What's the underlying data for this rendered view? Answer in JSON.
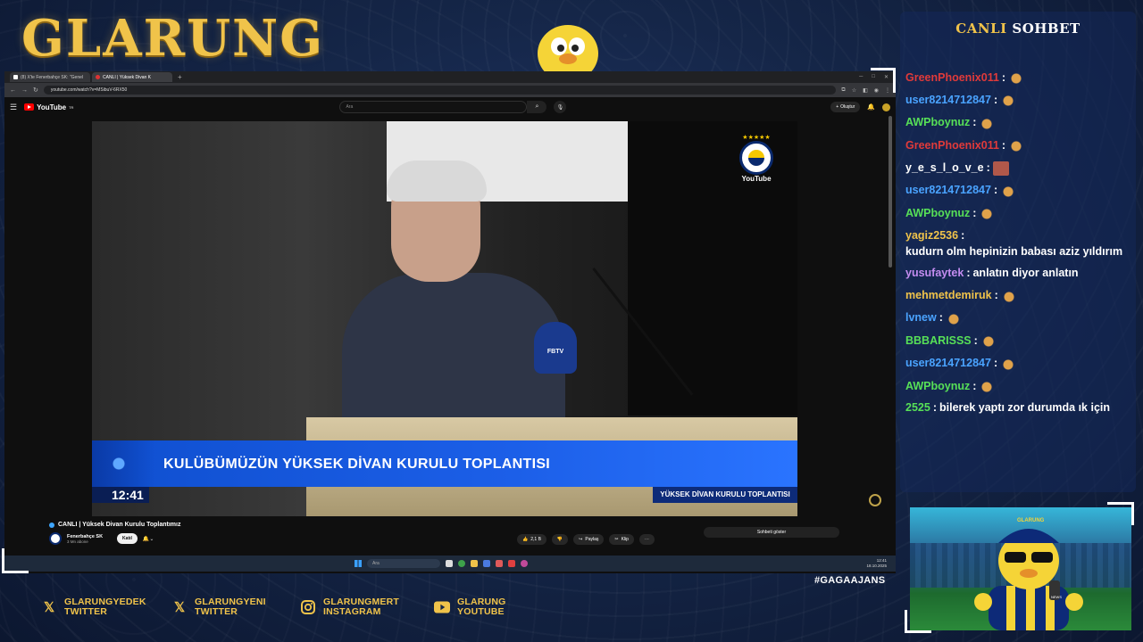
{
  "overlay": {
    "logo": "GLARUNG",
    "hashtag": "#GAGAAJANS",
    "chat_title_a": "CANLI",
    "chat_title_b": "SOHBET"
  },
  "browser": {
    "tabs": [
      {
        "label": "(8) X'te Fenerbahçe SK: \"Genel",
        "icon": "x-icon"
      },
      {
        "label": "CANLI | Yüksek Divan K",
        "icon": "youtube-icon"
      }
    ],
    "url": "youtube.com/watch?v=MSibuV-6RX50"
  },
  "youtube": {
    "logo": "YouTube",
    "logo_sup": "TR",
    "search_placeholder": "Ara",
    "create_label": "Oluştur"
  },
  "video": {
    "crest_label": "YouTube",
    "mic_label": "FBTV",
    "banner_text": "KULÜBÜMÜZÜN YÜKSEK DİVAN KURULU TOPLANTISI",
    "clock": "12:41",
    "sub_tag": "YÜKSEK DİVAN KURULU TOPLANTISI",
    "title": "CANLI | Yüksek Divan Kurulu Toplantımız",
    "channel": "Fenerbahçe SK",
    "subscribers": "3 Mn abone",
    "join_label": "Katıl",
    "likes": "2,1 B",
    "share_label": "Paylaş",
    "clip_label": "Klip",
    "chat_toggle": "Sohbeti göster"
  },
  "taskbar": {
    "search": "Ara",
    "time": "12:41",
    "date": "18.10.2025"
  },
  "chat": [
    {
      "user": "GreenPhoenix011",
      "user_color": "#e03a3a",
      "text": "",
      "emote": "wave-emote"
    },
    {
      "user": "user8214712847",
      "user_color": "#4aa3ff",
      "text": "",
      "emote": "wave-emote"
    },
    {
      "user": "AWPboynuz",
      "user_color": "#57e057",
      "text": "",
      "emote": "wave-emote"
    },
    {
      "user": "GreenPhoenix011",
      "user_color": "#e03a3a",
      "text": "",
      "emote": "wave-emote"
    },
    {
      "user": "y_e_s_l_o_v_e",
      "user_color": "#ffffff",
      "text": "",
      "emote": "box-emote"
    },
    {
      "user": "user8214712847",
      "user_color": "#4aa3ff",
      "text": "",
      "emote": "wave-emote"
    },
    {
      "user": "AWPboynuz",
      "user_color": "#57e057",
      "text": "",
      "emote": "wave-emote"
    },
    {
      "user": "yagiz2536",
      "user_color": "#f0c34a",
      "text": "kudurn olm hepinizin babası aziz yıldırım",
      "emote": ""
    },
    {
      "user": "yusufaytek",
      "user_color": "#c38cf0",
      "text": "anlatın diyor anlatın",
      "emote": ""
    },
    {
      "user": "mehmetdemiruk",
      "user_color": "#f0c34a",
      "text": "",
      "emote": "wave-emote"
    },
    {
      "user": "lvnew",
      "user_color": "#4aa3ff",
      "text": "",
      "emote": "wave-emote"
    },
    {
      "user": "BBBARISSS",
      "user_color": "#57e057",
      "text": "",
      "emote": "wave-emote"
    },
    {
      "user": "user8214712847",
      "user_color": "#4aa3ff",
      "text": "",
      "emote": "wave-emote"
    },
    {
      "user": "AWPboynuz",
      "user_color": "#57e057",
      "text": "",
      "emote": "wave-emote"
    },
    {
      "user": "2525",
      "user_color": "#57e057",
      "text": "bilerek yaptı zor durumda ık için",
      "emote": ""
    }
  ],
  "webcam": {
    "cap_label": "GLARUNG",
    "mic_tag": "NEWS"
  },
  "socials": [
    {
      "icon": "x-icon",
      "line1": "GLARUNGYEDEK",
      "line2": "TWITTER"
    },
    {
      "icon": "x-icon",
      "line1": "GLARUNGYENI",
      "line2": "TWITTER"
    },
    {
      "icon": "instagram-icon",
      "line1": "GLARUNGMERT",
      "line2": "INSTAGRAM"
    },
    {
      "icon": "youtube-icon",
      "line1": "GLARUNG",
      "line2": "YOUTUBE"
    }
  ]
}
